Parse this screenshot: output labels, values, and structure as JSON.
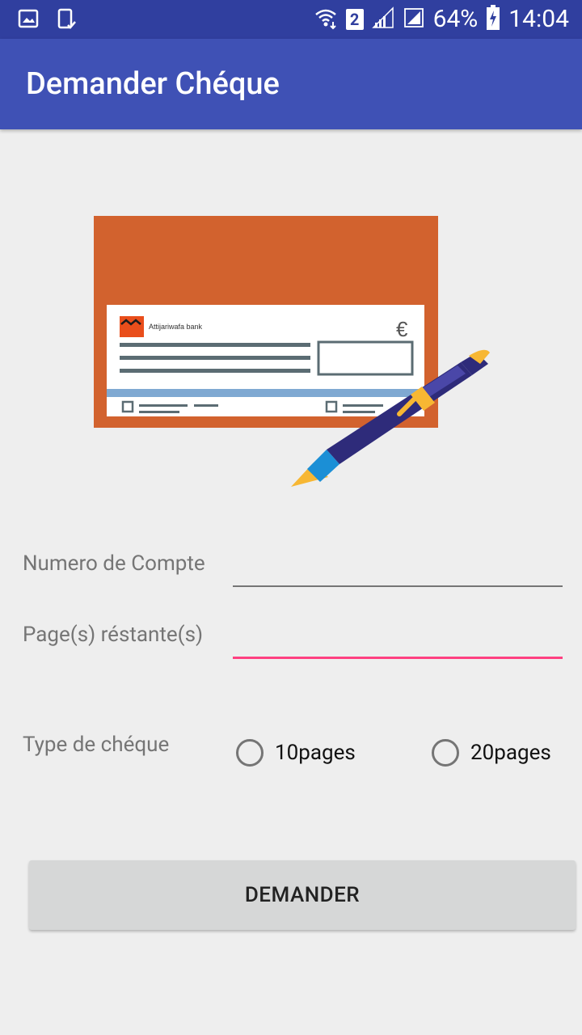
{
  "status_bar": {
    "battery_percent": "64%",
    "time": "14:04",
    "sim_slot": "2",
    "left_icons": [
      "image-icon",
      "phone-check-icon"
    ],
    "right_icons": [
      "wifi-icon",
      "sim-2-icon",
      "signal-icon",
      "signal-icon",
      "battery-charging-icon"
    ]
  },
  "app_bar": {
    "title": "Demander Chéque",
    "color": "#3f51b5"
  },
  "illustration": {
    "name": "cheque-and-pen",
    "currency_symbol": "€",
    "bank_name": "Attijariwafa bank",
    "colors": {
      "card": "#d2622e",
      "pen_body": "#2e2b7a",
      "pen_accent": "#f7b733",
      "pen_tip": "#1b8fd6"
    }
  },
  "form": {
    "account_number": {
      "label": "Numero de Compte",
      "value": ""
    },
    "remaining_pages": {
      "label": "Page(s) réstante(s)",
      "value": ""
    },
    "cheque_type": {
      "label": "Type de chéque",
      "options": [
        {
          "label": "10pages",
          "selected": false
        },
        {
          "label": "20pages",
          "selected": false
        }
      ]
    },
    "submit_label": "DEMANDER"
  },
  "colors": {
    "status_bar": "#303f9f",
    "accent": "#ff4081",
    "background": "#eeeeee"
  }
}
